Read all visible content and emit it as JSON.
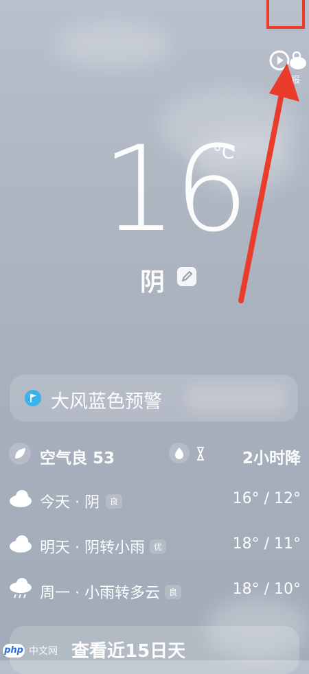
{
  "current": {
    "temperature": "16",
    "unit": "°C",
    "condition": "阴"
  },
  "top_right": {
    "label_fragment": "报"
  },
  "alert": {
    "text": "大风蓝色预警"
  },
  "air_quality": {
    "label": "空气良 53"
  },
  "precip": {
    "label": "2小时降"
  },
  "forecast": [
    {
      "day": "今天 · 阴",
      "badge": "良",
      "range": "16° / 12°",
      "icon": "cloud-icon"
    },
    {
      "day": "明天 · 阴转小雨",
      "badge": "优",
      "range": "18° / 11°",
      "icon": "cloud-icon"
    },
    {
      "day": "周一 · 小雨转多云",
      "badge": "良",
      "range": "18° / 10°",
      "icon": "rain-cloud-icon"
    }
  ],
  "bottom_button": {
    "label": "查看近15日天"
  },
  "watermark": {
    "logo": "php",
    "text": "中文网"
  },
  "colors": {
    "alert_icon": "#39b3e9",
    "annotation_red": "#ea3c2a"
  }
}
